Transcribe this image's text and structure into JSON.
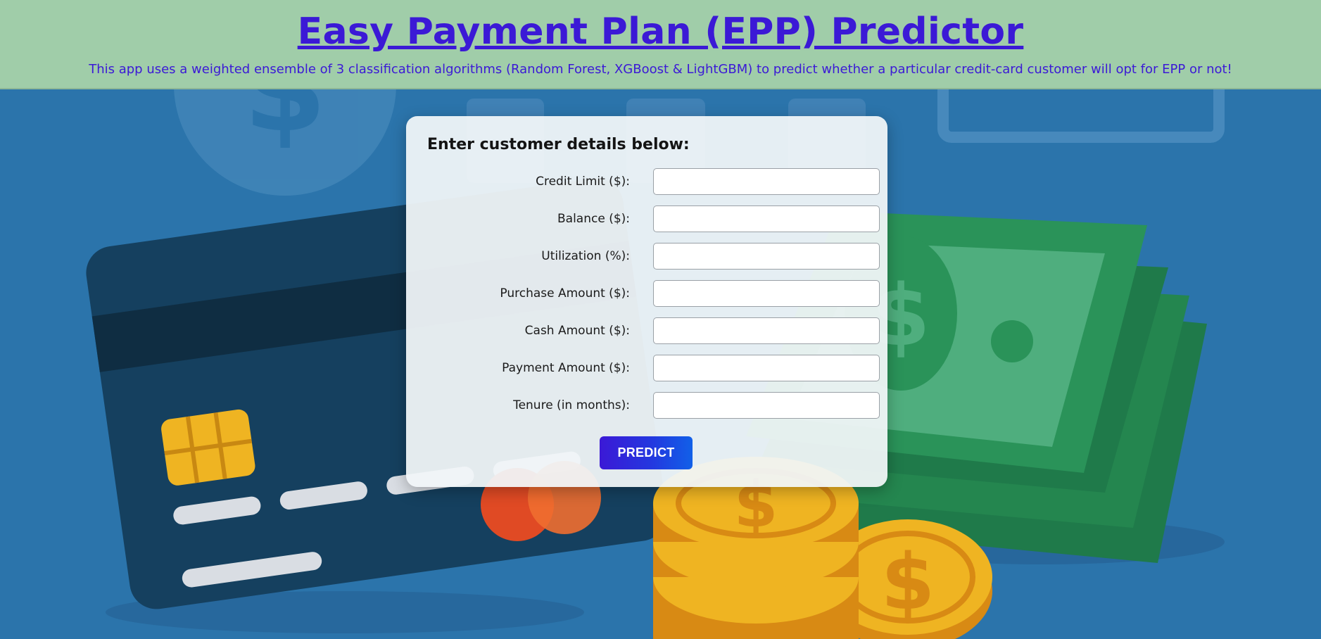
{
  "header": {
    "title": "Easy Payment Plan (EPP) Predictor",
    "subtitle": "This app uses a weighted ensemble of 3 classification algorithms (Random Forest, XGBoost & LightGBM) to predict whether a particular credit-card customer will opt for EPP or not!"
  },
  "form": {
    "heading": "Enter customer details below:",
    "fields": [
      {
        "label": "Credit Limit ($):",
        "value": "",
        "placeholder": ""
      },
      {
        "label": "Balance ($):",
        "value": "",
        "placeholder": ""
      },
      {
        "label": "Utilization (%):",
        "value": "",
        "placeholder": ""
      },
      {
        "label": "Purchase Amount ($):",
        "value": "",
        "placeholder": ""
      },
      {
        "label": "Cash Amount ($):",
        "value": "",
        "placeholder": ""
      },
      {
        "label": "Payment Amount ($):",
        "value": "",
        "placeholder": ""
      },
      {
        "label": "Tenure (in months):",
        "value": "",
        "placeholder": ""
      }
    ],
    "submit_label": "PREDICT"
  },
  "background": {
    "icons": [
      "dollar-coin-icon",
      "credit-card-icon",
      "banknote-stack-icon",
      "coin-stack-icon"
    ]
  },
  "colors": {
    "header_bg": "#a0cda9",
    "title": "#3b19d6",
    "page_bg": "#2b74ab",
    "button_start": "#3b19d6",
    "button_end": "#1160e8"
  }
}
